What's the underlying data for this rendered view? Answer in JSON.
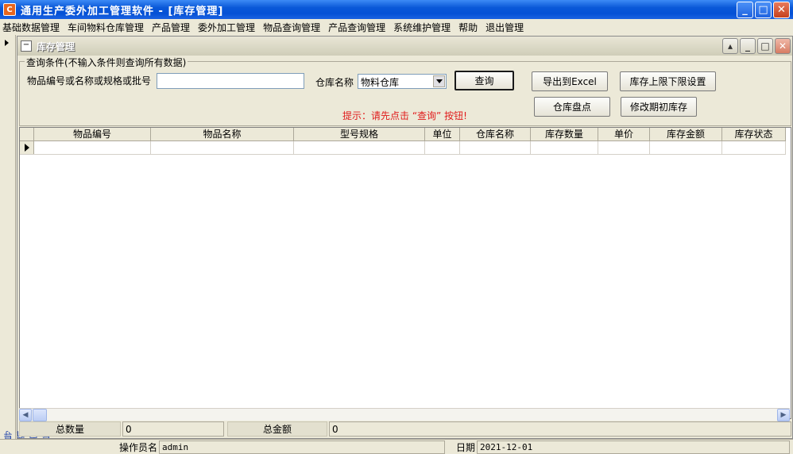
{
  "window": {
    "title": "通用生产委外加工管理软件   - [库存管理]",
    "icon_text": "C"
  },
  "menu": [
    "基础数据管理",
    "车间物料仓库管理",
    "产品管理",
    "委外加工管理",
    "物品查询管理",
    "产品查询管理",
    "系统维护管理",
    "帮助",
    "退出管理"
  ],
  "nav": {
    "label": "导航向导"
  },
  "child": {
    "title": "库存管理",
    "icon": "minus-box-icon"
  },
  "query": {
    "legend": "查询条件(不输入条件则查询所有数据)",
    "item_label": "物品编号或名称或规格或批号",
    "item_value": "",
    "warehouse_label": "仓库名称",
    "warehouse_value": "物料仓库",
    "query_button": "查询",
    "export_button": "导出到Excel",
    "limit_button": "库存上限下限设置",
    "inventory_button": "仓库盘点",
    "modify_button": "修改期初库存",
    "hint": "提示：请先点击 “查询” 按钮!"
  },
  "grid": {
    "columns": [
      "物品编号",
      "物品名称",
      "型号规格",
      "单位",
      "仓库名称",
      "库存数量",
      "单价",
      "库存金额",
      "库存状态"
    ]
  },
  "totals": {
    "qty_label": "总数量",
    "qty_value": "0",
    "amount_label": "总金额",
    "amount_value": "0"
  },
  "status": {
    "operator_label": "操作员名",
    "operator_value": "admin",
    "date_label": "日期",
    "date_value": "2021-12-01"
  }
}
